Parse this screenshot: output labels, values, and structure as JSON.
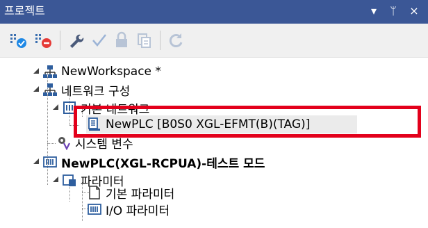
{
  "panel": {
    "title": "프로젝트",
    "controls": {
      "dropdown_icon": "chevron-down-icon",
      "pin_icon": "pin-icon",
      "close_icon": "close-icon",
      "dropdown_glyph": "▾",
      "pin_glyph": "ᛘ",
      "close_glyph": "×"
    }
  },
  "toolbar": {
    "buttons": [
      {
        "name": "connect-icon"
      },
      {
        "name": "disconnect-icon"
      },
      {
        "name": "wrench-icon"
      },
      {
        "name": "check-icon"
      },
      {
        "name": "lock-icon"
      },
      {
        "name": "copy-icon"
      },
      {
        "name": "refresh-icon"
      }
    ]
  },
  "tree": {
    "workspace": "NewWorkspace *",
    "network_config": "네트워크 구성",
    "basic_network": "기본 네트워크",
    "newplc_entry": "NewPLC [B0S0 XGL-EFMT(B)(TAG)]",
    "system_variables": "시스템 변수",
    "plc_node": "NewPLC(XGL-RCPUA)-테스트 모드",
    "parameters": "파라미터",
    "basic_parameters": "기본 파라미터",
    "io_parameters": "I/O 파라미터"
  },
  "colors": {
    "titlebar": "#3b5796",
    "highlight": "#e3001b"
  }
}
